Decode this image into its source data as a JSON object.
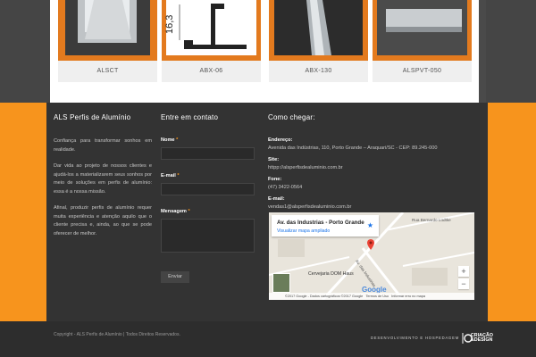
{
  "products": [
    {
      "caption": "ALSCT"
    },
    {
      "caption": "ABX-06",
      "dimension_label": "16,3"
    },
    {
      "caption": "ABX-130"
    },
    {
      "caption": "ALSPVT-050"
    }
  ],
  "about": {
    "title": "ALS Perfis de Alumínio",
    "paragraphs": [
      "Confiança para transformar sonhos em realidade.",
      "Dar vida ao projeto de nossos clientes e ajudá-los a materializarem seus sonhos por meio de soluções em perfis de alumínio: essa é a nossa missão.",
      "Afinal, produzir perfis de alumínio requer muita experiência e atenção aquilo que o cliente precisa e, ainda, ao que se pode oferecer de melhor."
    ]
  },
  "contact": {
    "title": "Entre em contato",
    "name_label": "Nome",
    "email_label": "E-mail",
    "message_label": "Mensagem",
    "required_mark": "*",
    "submit_label": "Enviar"
  },
  "location": {
    "title": "Como chegar:",
    "address_label": "Endereço:",
    "address": "Avenida das Indústrias, 110, Porto Grande – Araquari/SC - CEP: 89.245-000",
    "site_label": "Site:",
    "site": "httpp://alsperfisdealuminio.com.br",
    "phone_label": "Fone:",
    "phone": "(47) 3422-0564",
    "email_label": "E-mail:",
    "email": "vendas1@alsperfisdealuminio.com.br"
  },
  "map": {
    "place_title": "Av. das Industrias - Porto Grande",
    "enlarge_link": "Visualizar mapa ampliado",
    "street_1": "Rua Bernardo Lüdtke",
    "street_2": "Av. das Industrias",
    "poi": "Cervejaria DOM Haus",
    "brand": "Google",
    "attribution": "©2017 Google - Dados cartográficos ©2017 Google",
    "terms": "Termos de Uso",
    "report": "Informar erro no mapa",
    "zoom_in": "+",
    "zoom_out": "−"
  },
  "bottom": {
    "copyright": "Copyright - ALS Perfis de Alumínio | Todos Direitos Reservados.",
    "dev_text": "DESENVOLVIMENTO E HOSPEDAGEM",
    "logo_line1": "CRIAÇÃO",
    "logo_line2": "&DESIGN"
  },
  "colors": {
    "accent": "#f7941d",
    "footer_bg": "#333333"
  }
}
